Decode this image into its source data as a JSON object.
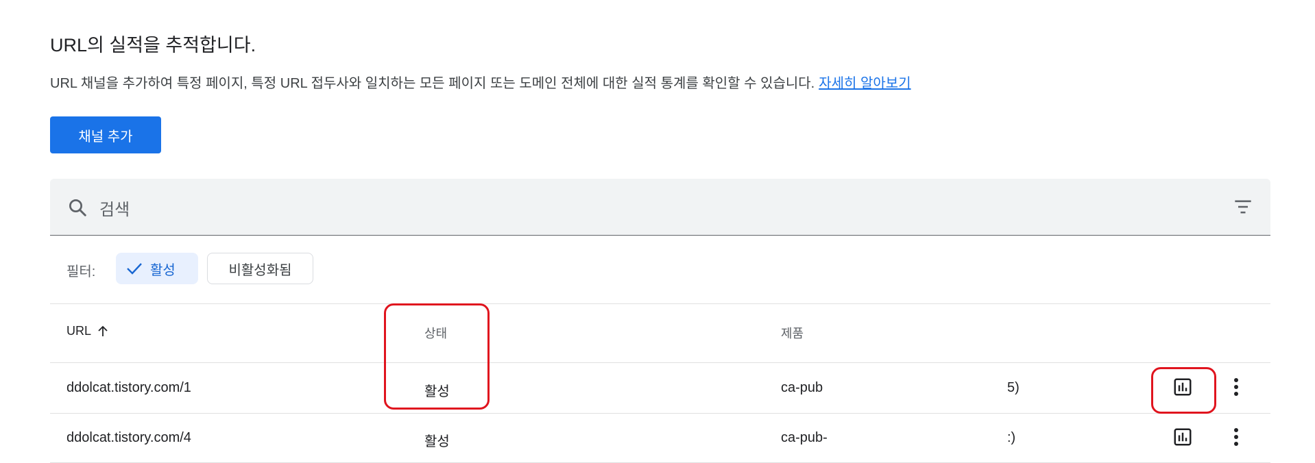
{
  "header": {
    "title": "URL의 실적을 추적합니다.",
    "description": "URL 채널을 추가하여 특정 페이지, 특정 URL 접두사와 일치하는 모든 페이지 또는 도메인 전체에 대한 실적 통계를 확인할 수 있습니다.",
    "learn_more": "자세히 알아보기"
  },
  "add_button": "채널 추가",
  "search": {
    "placeholder": "검색"
  },
  "filters": {
    "label": "필터:",
    "active_chip": "활성",
    "inactive_chip": "비활성화됨"
  },
  "table": {
    "columns": {
      "url": "URL",
      "status": "상태",
      "product": "제품"
    },
    "rows": [
      {
        "url": "ddolcat.tistory.com/1",
        "status": "활성",
        "product": "ca-pub",
        "extra": "5)"
      },
      {
        "url": "ddolcat.tistory.com/4",
        "status": "활성",
        "product": "ca-pub-",
        "extra": ":)"
      }
    ]
  },
  "icons": [
    "search-icon",
    "filter-list-icon",
    "check-icon",
    "arrow-up-icon",
    "bar-chart-icon",
    "more-vert-icon"
  ],
  "colors": {
    "accent": "#1a73e8",
    "annotation": "#e0141e",
    "chip_bg": "#e8f0fe"
  }
}
